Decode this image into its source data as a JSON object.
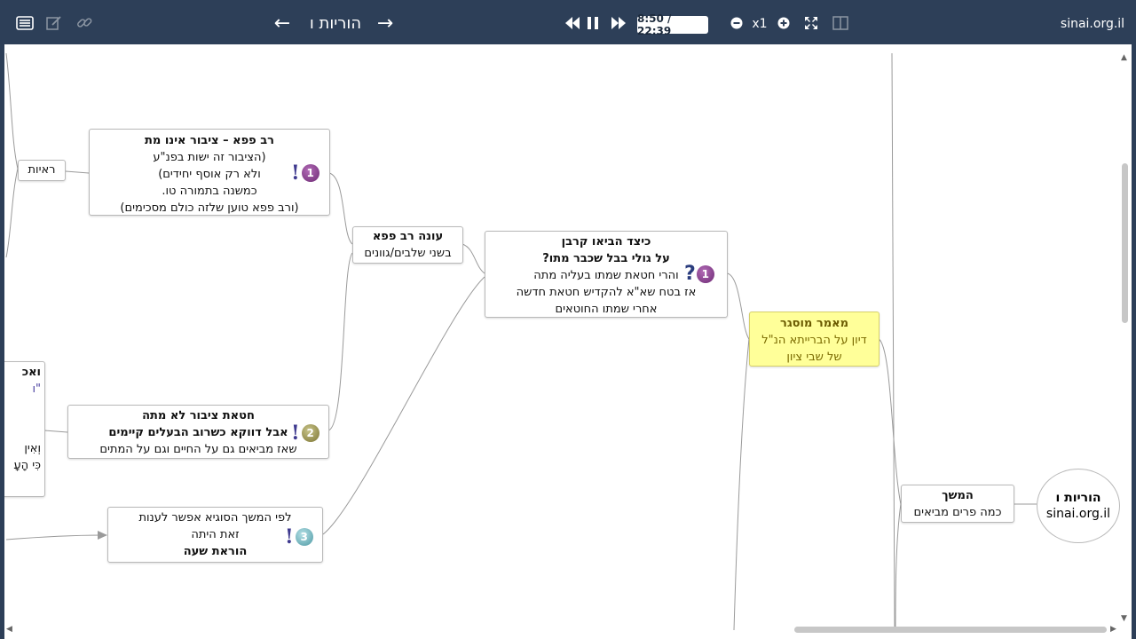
{
  "toolbar": {
    "chapter_title": "הוריות ו",
    "prev_arrow": "←",
    "next_arrow": "→",
    "time": "8:50 / 22:39",
    "speed": "x1",
    "site": "sinai.org.il",
    "icons": [
      "list-icon",
      "edit-icon",
      "link-icon",
      "rewind-icon",
      "pause-icon",
      "fast-forward-icon",
      "zoom-out-icon",
      "zoom-in-icon",
      "fullscreen-icon",
      "split-view-icon"
    ]
  },
  "nodes": {
    "raayot": {
      "label": "ראיות"
    },
    "rav_papa": {
      "title": "רב פפא – ציבור אינו מת",
      "lines": [
        "(הציבור זה ישות בפנ\"ע",
        "ולא רק אוסף יחידים)",
        "כמשנה בתמורה טו.",
        "(ורב פפא טוען שלזה כולם מסכימים)"
      ],
      "marker": "1"
    },
    "oneh_rav_papa": {
      "title": "עונה רב פפא",
      "line": "בשני שלבים/גוונים"
    },
    "keitzad": {
      "title": "כיצד הביאו קרבן",
      "title2": "על גולי בבל שכבר מתו?",
      "lines": [
        "והרי חטאת שמתו בעליה מתה",
        "אז בטח שא\"א להקדיש חטאת חדשה",
        "אחרי שמתו החוטאים"
      ],
      "marker": "1"
    },
    "chatat_tzibur": {
      "title": "חטאת ציבור לא מתה",
      "title2": "אבל דווקא כשרוב הבעלים קיימים",
      "line": "שאז מביאים גם על החיים וגם על המתים",
      "marker": "2"
    },
    "lefi_hamemshech": {
      "lines": [
        "לפי המשך הסוגיא אפשר לענות",
        "זאת היתה"
      ],
      "title": "הוראת שעה",
      "marker": "3"
    },
    "maamar": {
      "title": "מאמר מוסגר",
      "lines": [
        "דיון על הברייתא הנ\"ל",
        "של שבי ציון"
      ]
    },
    "hemshech": {
      "title": "המשך",
      "line": "כמה פרים מביאים"
    },
    "root": {
      "title": "הוריות ו",
      "line": "sinai.org.il"
    },
    "partial": {
      "l1": "ואכ",
      "l2": "\"ו",
      "l3": "וְאִין",
      "l4": "כִּי הָעָ"
    }
  },
  "colors": {
    "toolbar": "#2d3f58",
    "yellow": "#ffff99"
  }
}
